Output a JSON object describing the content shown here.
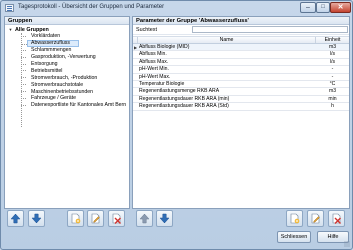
{
  "window": {
    "title": "Tagesprotokoll - Übersicht der Gruppen und Parameter",
    "minimize_glyph": "–",
    "maximize_glyph": "□",
    "close_glyph": "✕"
  },
  "groups": {
    "header": "Gruppen",
    "root_label": "Alle Gruppen",
    "root_toggle": "▼",
    "items": [
      {
        "label": "Vorklärdaten"
      },
      {
        "label": "Abwasserzufluss"
      },
      {
        "label": "Schlammmengen"
      },
      {
        "label": "Gasproduktion, -Verwertung"
      },
      {
        "label": "Entsorgung"
      },
      {
        "label": "Betriebsmittel"
      },
      {
        "label": "Stromverbrauch, -Produktion"
      },
      {
        "label": "Stromverbrauchstotale"
      },
      {
        "label": "Maschinenbetriebsstunden"
      },
      {
        "label": "Fahrzeuge / Geräte"
      },
      {
        "label": "Datenexportliste für Kantonales Amt Bern"
      }
    ],
    "selected_index": 1
  },
  "parameters": {
    "header": "Parameter der Gruppe 'Abwasserzufluss'",
    "search_label": "Suchtext",
    "search_value": "",
    "columns": {
      "name": "Name",
      "unit": "Einheit"
    },
    "current_row_marker": "▶",
    "rows": [
      {
        "name": "Abfluss Biologie (MID)",
        "unit": "m3"
      },
      {
        "name": "Abfluss Min.",
        "unit": "l/s"
      },
      {
        "name": "Abfluss Max.",
        "unit": "l/s"
      },
      {
        "name": "pH-Wert Min.",
        "unit": "-"
      },
      {
        "name": "pH-Wert Max.",
        "unit": "-"
      },
      {
        "name": "Temperatur Biologie",
        "unit": "°C"
      },
      {
        "name": "Regenentlastungsmenge RKB ARA",
        "unit": "m3"
      },
      {
        "name": "Regenentlastungsdauer RKB ARA (min)",
        "unit": "min"
      },
      {
        "name": "Regenentlastungsdauer RKB ARA (Std)",
        "unit": "h"
      }
    ]
  },
  "toolbar": {
    "icons": [
      "arrow-up-icon",
      "arrow-down-icon",
      "new-document-icon",
      "edit-document-icon",
      "delete-document-icon"
    ]
  },
  "buttons": {
    "close_label": "Schliessen",
    "help_label": "Hilfe"
  },
  "colors": {
    "accent": "#2f6db5",
    "delete": "#d0312d",
    "selection": "#dcebfb"
  }
}
